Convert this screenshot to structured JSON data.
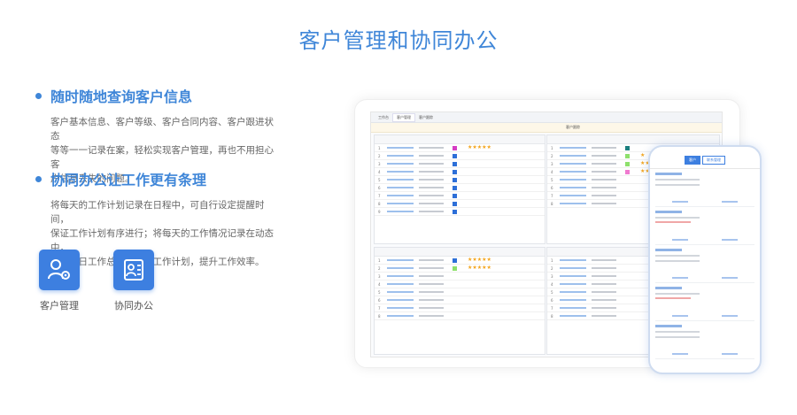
{
  "page": {
    "title": "客户管理和协同办公"
  },
  "features": [
    {
      "title": "随时随地查询客户信息",
      "lines": [
        "客户基本信息、客户等级、客户合同内容、客户跟进状态",
        "等等一一记录在案，轻松实现客户管理，再也不用担心客",
        "户信息丢失的问题。"
      ]
    },
    {
      "title": "协同办公让工作更有条理",
      "lines": [
        "将每天的工作计划记录在日程中，可自行设定提醒时间，",
        "保证工作计划有序进行；将每天的工作情况记录在动态中，",
        "包括今日工作总结及明日工作计划，提升工作效率。"
      ]
    }
  ],
  "modules": [
    {
      "label": "客户管理",
      "icon": "customer-management-icon"
    },
    {
      "label": "协同办公",
      "icon": "collaboration-icon"
    }
  ],
  "colors": {
    "accent": "#3f86d8",
    "tile": "#3d7fe0",
    "star": "#f3a51d"
  },
  "tablet": {
    "tabs": [
      "工作台",
      "客户管理",
      "客户跟踪"
    ],
    "banner_center": "客户跟踪"
  },
  "phone": {
    "segments": [
      "客户",
      "联系管理"
    ]
  }
}
